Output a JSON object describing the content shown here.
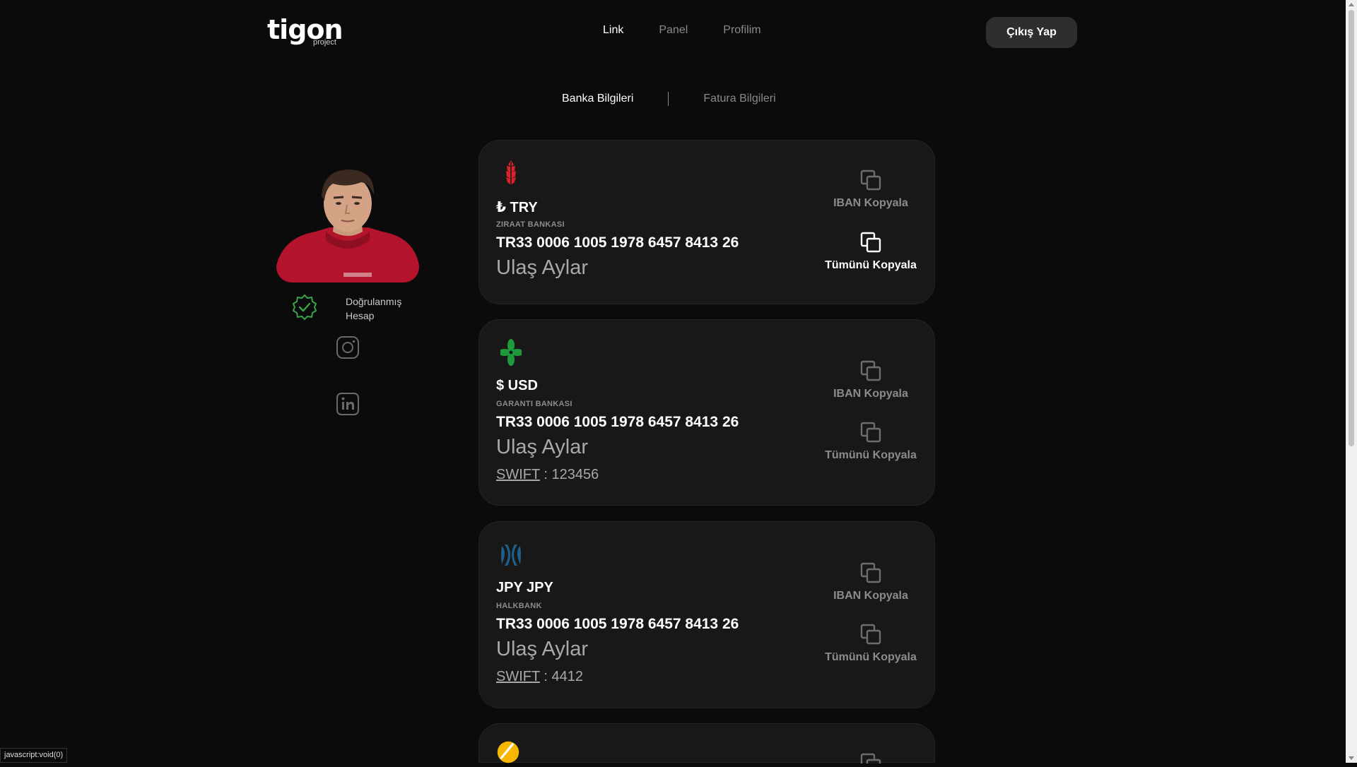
{
  "header": {
    "logo_text": "tigon",
    "logo_sub": "project",
    "nav": [
      {
        "label": "Link"
      },
      {
        "label": "Panel"
      },
      {
        "label": "Profilim"
      }
    ],
    "logout_label": "Çıkış Yap"
  },
  "subtabs": [
    {
      "label": "Banka Bilgileri"
    },
    {
      "label": "Fatura Bilgileri"
    }
  ],
  "profile": {
    "verified_line1": "Doğrulanmış",
    "verified_line2": "Hesap"
  },
  "accounts": [
    {
      "currency": "₺ TRY",
      "bank": "ZIRAAT BANKASI",
      "iban": "TR33 0006 1005 1978 6457 8413 26",
      "holder": "Ulaş Aylar",
      "copy_iban_label": "IBAN Kopyala",
      "copy_all_label": "Tümünü Kopyala"
    },
    {
      "currency": "$ USD",
      "bank": "GARANTI BANKASI",
      "iban": "TR33 0006 1005 1978 6457 8413 26",
      "holder": "Ulaş Aylar",
      "swift_label": "SWIFT",
      "swift_value": ": 123456",
      "copy_iban_label": "IBAN Kopyala",
      "copy_all_label": "Tümünü Kopyala"
    },
    {
      "currency": "JPY JPY",
      "bank": "HALKBANK",
      "iban": "TR33 0006 1005 1978 6457 8413 26",
      "holder": "Ulaş Aylar",
      "swift_label": "SWIFT",
      "swift_value": ": 4412",
      "copy_iban_label": "IBAN Kopyala",
      "copy_all_label": "Tümünü Kopyala"
    }
  ],
  "status_text": "javascript:void(0)",
  "colors": {
    "background": "#0b0b0b",
    "card": "#181818",
    "verified_green": "#3aa34a",
    "ziraat_red": "#d8232a",
    "garanti_green": "#1e9a3c",
    "halkbank_blue": "#1f5f8b",
    "vakif_yellow": "#f5b700"
  }
}
